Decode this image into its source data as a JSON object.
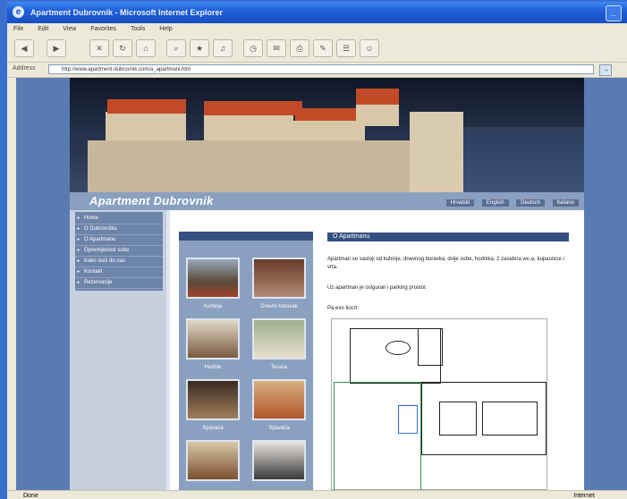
{
  "window": {
    "title": "Apartment Dubrovnik - Microsoft Internet Explorer",
    "minimize_label": "_"
  },
  "menubar": [
    "File",
    "Edit",
    "View",
    "Favorites",
    "Tools",
    "Help"
  ],
  "toolbar": {
    "back": "◀",
    "forward": "▶",
    "icons": [
      "stop-icon",
      "refresh-icon",
      "home-icon",
      "search-icon",
      "favorites-icon",
      "media-icon",
      "history-icon",
      "mail-icon",
      "print-icon",
      "edit-icon",
      "discuss-icon",
      "messenger-icon"
    ]
  },
  "address": {
    "label": "Address",
    "url": "http://www.apartment-dubrovnik.com/a_apartmani.htm",
    "go": "→"
  },
  "site": {
    "logo": "Apartment Dubrovnik",
    "top_links": [
      "Hrvatski",
      "English",
      "Deutsch",
      "Italiano"
    ],
    "menu": [
      "Home",
      "O Dubrovniku",
      "O Apartmanu",
      "Opremljenost sobe",
      "Kako doći do nas",
      "Kontakt",
      "Rezervacije"
    ],
    "gallery_captions": [
      "Kuhinja",
      "Dnevni boravak",
      "Hodnik",
      "Terasa",
      "Spavaća",
      "Spavaća"
    ],
    "article_title": "O Apartmanu",
    "paragraphs": [
      "Apartman se sastoji od kuhinje, dnevnog boravka, dvije sobe, hodnika, 2 zasebna wc-a, kupaonice i vrta.",
      "Uz apartman je osiguran i parking prostor.",
      "Pa evo tlocrt:"
    ]
  },
  "statusbar": {
    "text": "Done",
    "zone": "Internet"
  }
}
